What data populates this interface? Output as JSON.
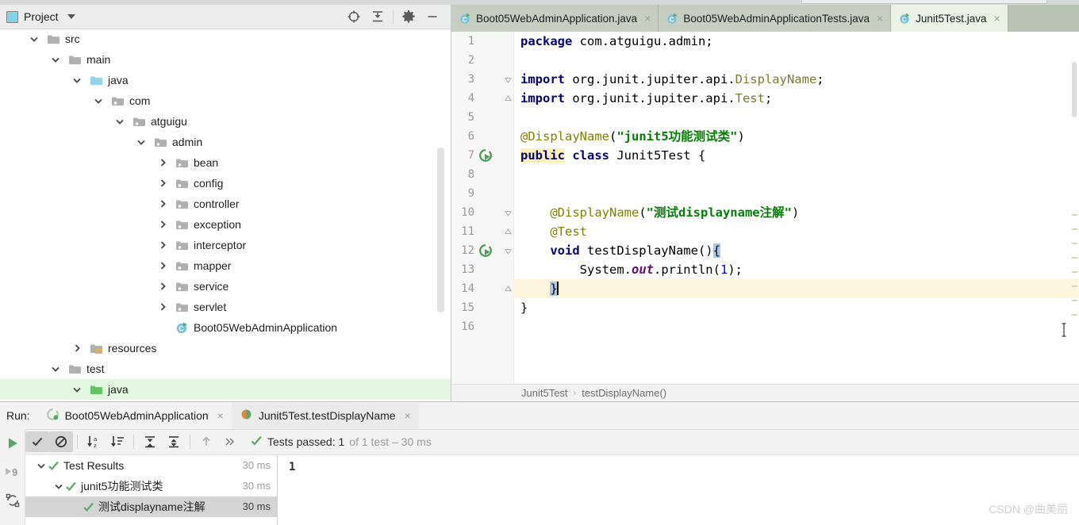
{
  "project_panel": {
    "title": "Project",
    "title_icon": "project-window-icon",
    "tools": [
      {
        "name": "locate-icon",
        "label": "Select Opened File"
      },
      {
        "name": "collapse-all-icon",
        "label": "Collapse All"
      },
      {
        "name": "gear-icon",
        "label": "Settings"
      },
      {
        "name": "minimize-icon",
        "label": "Hide"
      }
    ],
    "tree": [
      {
        "label": "src",
        "indent": 1,
        "arrow": "down",
        "icon": "folder-gray",
        "selected": false
      },
      {
        "label": "main",
        "indent": 2,
        "arrow": "down",
        "icon": "folder-gray",
        "selected": false
      },
      {
        "label": "java",
        "indent": 3,
        "arrow": "down",
        "icon": "folder-blue",
        "selected": false
      },
      {
        "label": "com",
        "indent": 4,
        "arrow": "down",
        "icon": "folder-pkg",
        "selected": false
      },
      {
        "label": "atguigu",
        "indent": 5,
        "arrow": "down",
        "icon": "folder-pkg",
        "selected": false
      },
      {
        "label": "admin",
        "indent": 6,
        "arrow": "down",
        "icon": "folder-pkg",
        "selected": false
      },
      {
        "label": "bean",
        "indent": 7,
        "arrow": "right",
        "icon": "folder-pkg",
        "selected": false
      },
      {
        "label": "config",
        "indent": 7,
        "arrow": "right",
        "icon": "folder-pkg",
        "selected": false
      },
      {
        "label": "controller",
        "indent": 7,
        "arrow": "right",
        "icon": "folder-pkg",
        "selected": false
      },
      {
        "label": "exception",
        "indent": 7,
        "arrow": "right",
        "icon": "folder-pkg",
        "selected": false
      },
      {
        "label": "interceptor",
        "indent": 7,
        "arrow": "right",
        "icon": "folder-pkg",
        "selected": false
      },
      {
        "label": "mapper",
        "indent": 7,
        "arrow": "right",
        "icon": "folder-pkg",
        "selected": false
      },
      {
        "label": "service",
        "indent": 7,
        "arrow": "right",
        "icon": "folder-pkg",
        "selected": false
      },
      {
        "label": "servlet",
        "indent": 7,
        "arrow": "right",
        "icon": "folder-pkg",
        "selected": false
      },
      {
        "label": "Boot05WebAdminApplication",
        "indent": 7,
        "arrow": "none",
        "icon": "java-run-class",
        "selected": false
      },
      {
        "label": "resources",
        "indent": 3,
        "arrow": "right",
        "icon": "folder-res",
        "selected": false
      },
      {
        "label": "test",
        "indent": 2,
        "arrow": "down",
        "icon": "folder-gray",
        "selected": false
      },
      {
        "label": "java",
        "indent": 3,
        "arrow": "down",
        "icon": "folder-green",
        "selected": true
      }
    ]
  },
  "editor": {
    "tabs": [
      {
        "label": "Boot05WebAdminApplication.java",
        "active": false,
        "icon": "java-class-icon",
        "close": "×"
      },
      {
        "label": "Boot05WebAdminApplicationTests.java",
        "active": false,
        "icon": "java-class-icon",
        "close": "×"
      },
      {
        "label": "Junit5Test.java",
        "active": true,
        "icon": "java-class-icon",
        "close": "×"
      }
    ],
    "line_numbers": [
      "1",
      "2",
      "3",
      "4",
      "5",
      "6",
      "7",
      "8",
      "9",
      "10",
      "11",
      "12",
      "13",
      "14",
      "15",
      "16"
    ],
    "current_line": 14,
    "gutter_run_lines": [
      7,
      12
    ],
    "lines": [
      "package com.atguigu.admin;",
      "",
      "import org.junit.jupiter.api.DisplayName;",
      "import org.junit.jupiter.api.Test;",
      "",
      "@DisplayName(\"junit5功能测试类\")",
      "public class Junit5Test {",
      "",
      "",
      "    @DisplayName(\"测试displayname注解\")",
      "    @Test",
      "    void testDisplayName(){",
      "        System.out.println(1);",
      "    }",
      "}",
      ""
    ],
    "breadcrumb": [
      "Junit5Test",
      "testDisplayName()"
    ],
    "breadcrumb_separator": "›"
  },
  "run_panel": {
    "label": "Run:",
    "tabs": [
      {
        "label": "Boot05WebAdminApplication",
        "active": false,
        "icon": "spring-boot-icon",
        "close": "×"
      },
      {
        "label": "Junit5Test.testDisplayName",
        "active": true,
        "icon": "junit-icon",
        "close": "×"
      }
    ],
    "rail_icons": [
      {
        "name": "rerun-icon"
      },
      {
        "name": "rerun-failed-icon"
      },
      {
        "name": "toggle-auto-test-icon"
      }
    ],
    "toolbar": [
      {
        "name": "show-passed-toggle",
        "pressed": true
      },
      {
        "name": "show-ignored-toggle",
        "pressed": true
      },
      {
        "name": "sort-alphabetically-button",
        "pressed": false
      },
      {
        "name": "sort-by-duration-button",
        "pressed": false
      },
      {
        "name": "expand-all-button",
        "pressed": false
      },
      {
        "name": "collapse-all-button",
        "pressed": false
      },
      {
        "name": "previous-test-button",
        "pressed": false
      },
      {
        "name": "next-test-button",
        "pressed": false
      }
    ],
    "status": {
      "icon": "check-green-icon",
      "main": "Tests passed: 1",
      "dim": "of 1 test – 30 ms"
    },
    "results": [
      {
        "label": "Test Results",
        "indent": 0,
        "arrow": "down",
        "time": "30 ms",
        "selected": false
      },
      {
        "label": "junit5功能测试类",
        "indent": 1,
        "arrow": "down",
        "time": "30 ms",
        "selected": false
      },
      {
        "label": "测试displayname注解",
        "indent": 2,
        "arrow": "none",
        "time": "30 ms",
        "selected": true
      }
    ],
    "console_output": "1"
  },
  "watermark": "CSDN @曲美丽",
  "colors": {
    "accent_green": "#499c54",
    "selection_green": "#e3f6e0",
    "tab_active": "#e9f2e4",
    "tab_bar": "#b9c3b4",
    "current_line": "#fdf6dd",
    "brace_match": "#a8c8e8",
    "keyword": "#000080",
    "string": "#008000",
    "annotation": "#808000"
  }
}
